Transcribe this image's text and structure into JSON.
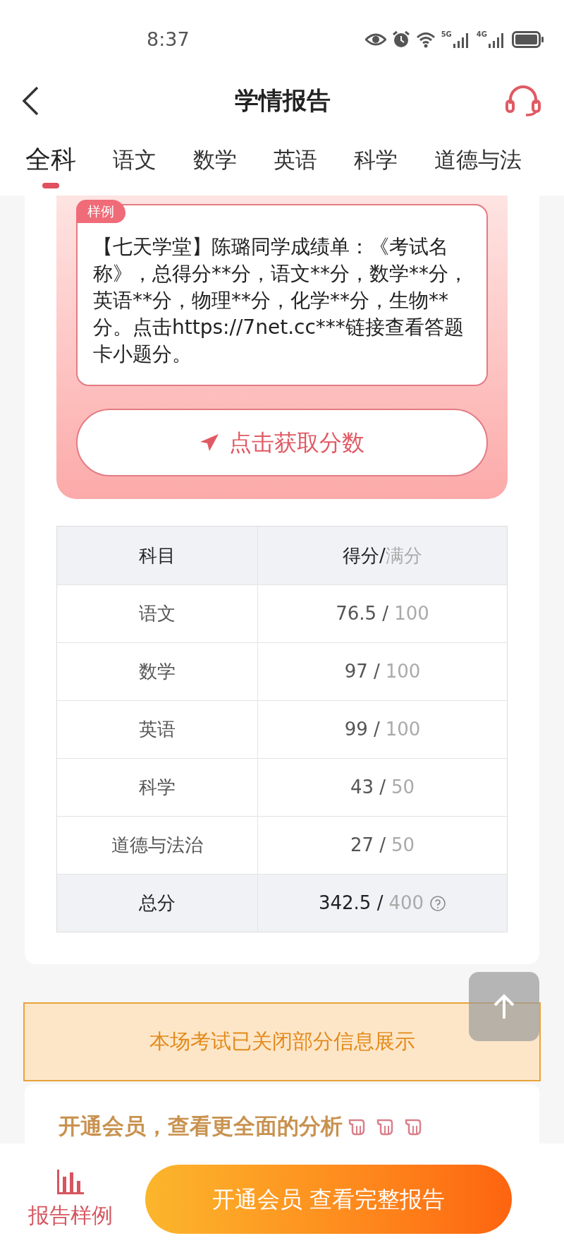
{
  "status_bar": {
    "time": "8:37",
    "signals": [
      {
        "label": "5G"
      },
      {
        "label": "4G"
      }
    ]
  },
  "header": {
    "title": "学情报告"
  },
  "tabs": [
    {
      "label": "全科",
      "selected": true
    },
    {
      "label": "语文",
      "selected": false
    },
    {
      "label": "数学",
      "selected": false
    },
    {
      "label": "英语",
      "selected": false
    },
    {
      "label": "科学",
      "selected": false
    },
    {
      "label": "道德与法",
      "selected": false
    }
  ],
  "sample": {
    "tag": "样例",
    "message": "【七天学堂】陈璐同学成绩单：《考试名称》，总得分**分，语文**分，数学**分，英语**分，物理**分，化学**分，生物**分。点击https://7net.cc***链接查看答题卡小题分。",
    "button": "点击获取分数"
  },
  "table": {
    "header": {
      "subject": "科目",
      "score": "得分/",
      "full": "满分"
    },
    "rows": [
      {
        "kind": "subject",
        "subject": "语文",
        "score": "76.5 /",
        "full": "100"
      },
      {
        "kind": "subject",
        "subject": "数学",
        "score": "97 /",
        "full": "100"
      },
      {
        "kind": "subject",
        "subject": "英语",
        "score": "99 /",
        "full": "100"
      },
      {
        "kind": "subject",
        "subject": "科学",
        "score": "43 /",
        "full": "50"
      },
      {
        "kind": "subject",
        "subject": "道德与法治",
        "score": "27 /",
        "full": "50"
      },
      {
        "kind": "total",
        "subject": "总分",
        "score": "342.5 /",
        "full": "400"
      }
    ]
  },
  "notice": "本场考试已关闭部分信息展示",
  "promo": {
    "title": "开通会员，查看更全面的分析"
  },
  "bottom_bar": {
    "sample_label": "报告样例",
    "cta": "开通会员 查看完整报告"
  }
}
